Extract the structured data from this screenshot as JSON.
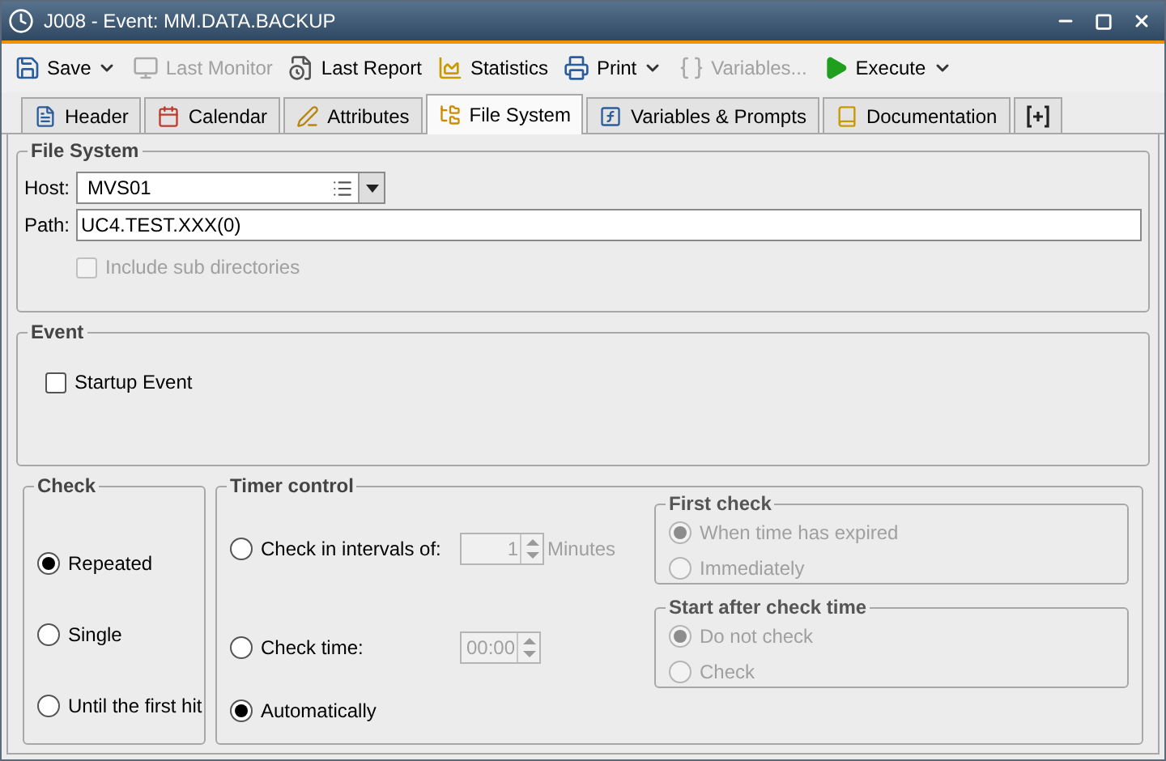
{
  "window": {
    "title": "J008 - Event: MM.DATA.BACKUP"
  },
  "toolbar": [
    {
      "label": "Save",
      "disabled": false,
      "dropdown": true
    },
    {
      "label": "Last Monitor",
      "disabled": true,
      "dropdown": false
    },
    {
      "label": "Last Report",
      "disabled": false,
      "dropdown": false
    },
    {
      "label": "Statistics",
      "disabled": false,
      "dropdown": false
    },
    {
      "label": "Print",
      "disabled": false,
      "dropdown": true
    },
    {
      "label": "Variables...",
      "disabled": true,
      "dropdown": false
    },
    {
      "label": "Execute",
      "disabled": false,
      "dropdown": true
    }
  ],
  "tabs": [
    {
      "label": "Header",
      "selected": false
    },
    {
      "label": "Calendar",
      "selected": false
    },
    {
      "label": "Attributes",
      "selected": false
    },
    {
      "label": "File System",
      "selected": true
    },
    {
      "label": "Variables & Prompts",
      "selected": false
    },
    {
      "label": "Documentation",
      "selected": false
    }
  ],
  "file_system": {
    "title": "File System",
    "host": {
      "label": "Host:",
      "value": "MVS01"
    },
    "path": {
      "label": "Path:",
      "value": "UC4.TEST.XXX(0)"
    },
    "include_sub": {
      "label": "Include sub directories",
      "checked": false,
      "disabled": true
    }
  },
  "event": {
    "title": "Event",
    "startup": {
      "label": "Startup Event",
      "checked": false
    }
  },
  "check": {
    "title": "Check",
    "options": [
      {
        "label": "Repeated",
        "selected": true
      },
      {
        "label": "Single",
        "selected": false
      },
      {
        "label": "Until the first hit",
        "selected": false
      }
    ]
  },
  "timer": {
    "title": "Timer control",
    "options": [
      {
        "label": "Check in intervals of:",
        "selected": false
      },
      {
        "label": "Check time:",
        "selected": false
      },
      {
        "label": "Automatically",
        "selected": true
      }
    ],
    "interval": {
      "value": "1",
      "unit": "Minutes",
      "disabled": true
    },
    "time": {
      "value": "00:00",
      "disabled": true
    },
    "first_check": {
      "title": "First check",
      "disabled": true,
      "options": [
        {
          "label": "When time has expired",
          "selected": true
        },
        {
          "label": "Immediately",
          "selected": false
        }
      ]
    },
    "start_after": {
      "title": "Start after check time",
      "disabled": true,
      "options": [
        {
          "label": "Do not check",
          "selected": true
        },
        {
          "label": "Check",
          "selected": false
        }
      ]
    }
  }
}
